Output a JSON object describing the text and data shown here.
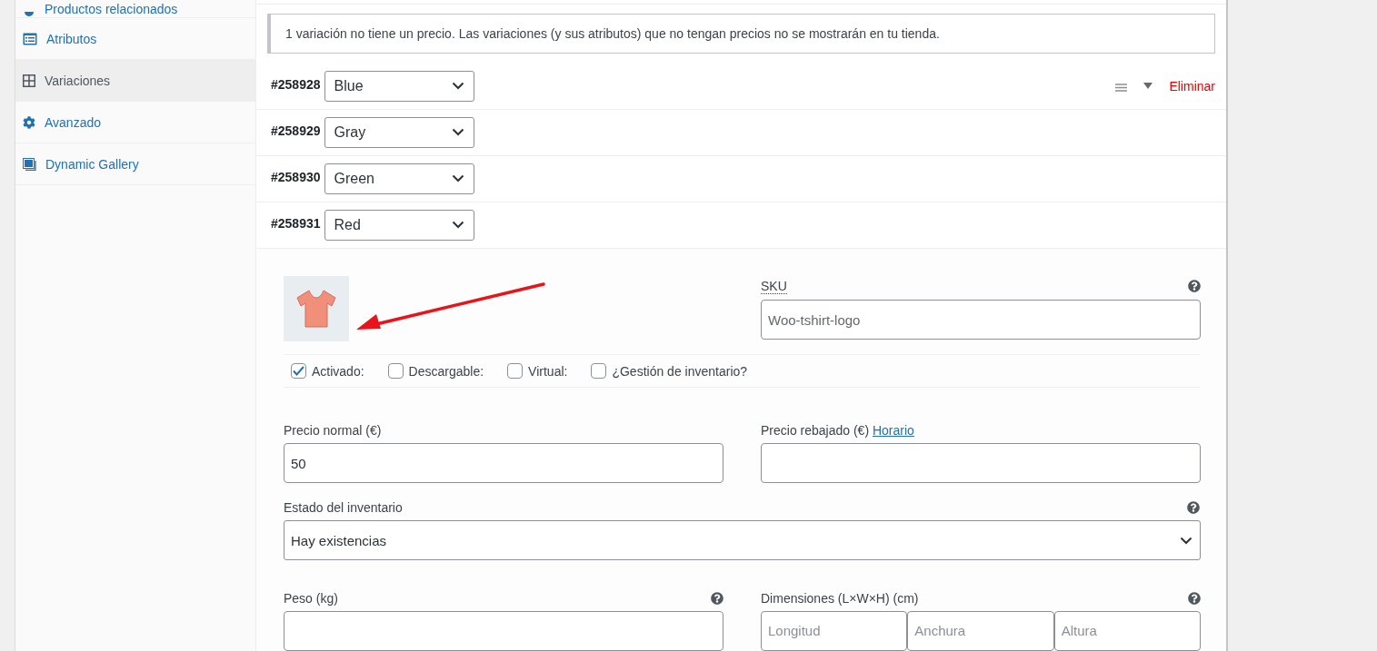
{
  "sidebar": {
    "items": [
      {
        "label": "Productos relacionados",
        "selected": false
      },
      {
        "label": "Atributos",
        "selected": false
      },
      {
        "label": "Variaciones",
        "selected": true
      },
      {
        "label": "Avanzado",
        "selected": false
      },
      {
        "label": "Dynamic Gallery",
        "selected": false
      }
    ]
  },
  "notice": "1 variación no tiene un precio. Las variaciones (y sus atributos) que no tengan precios no se mostrarán en tu tienda.",
  "variations": [
    {
      "id": "#258928",
      "value": "Blue",
      "expanded": false,
      "remove_label": "Eliminar"
    },
    {
      "id": "#258929",
      "value": "Gray",
      "expanded": false
    },
    {
      "id": "#258930",
      "value": "Green",
      "expanded": false
    },
    {
      "id": "#258931",
      "value": "Red",
      "expanded": true
    }
  ],
  "detail": {
    "sku": {
      "label": "SKU",
      "value": "Woo-tshirt-logo"
    },
    "checkboxes": [
      {
        "label": "Activado:",
        "checked": true
      },
      {
        "label": "Descargable:",
        "checked": false
      },
      {
        "label": "Virtual:",
        "checked": false
      },
      {
        "label": "¿Gestión de inventario?",
        "checked": false
      }
    ],
    "regular_price": {
      "label": "Precio normal (€)",
      "value": "50"
    },
    "sale_price": {
      "label": "Precio rebajado (€)",
      "link": "Horario"
    },
    "stock_status": {
      "label": "Estado del inventario",
      "value": "Hay existencias"
    },
    "weight": {
      "label": "Peso (kg)"
    },
    "dimensions": {
      "label": "Dimensiones (L×W×H) (cm)",
      "placeholders": [
        "Longitud",
        "Anchura",
        "Altura"
      ]
    }
  }
}
